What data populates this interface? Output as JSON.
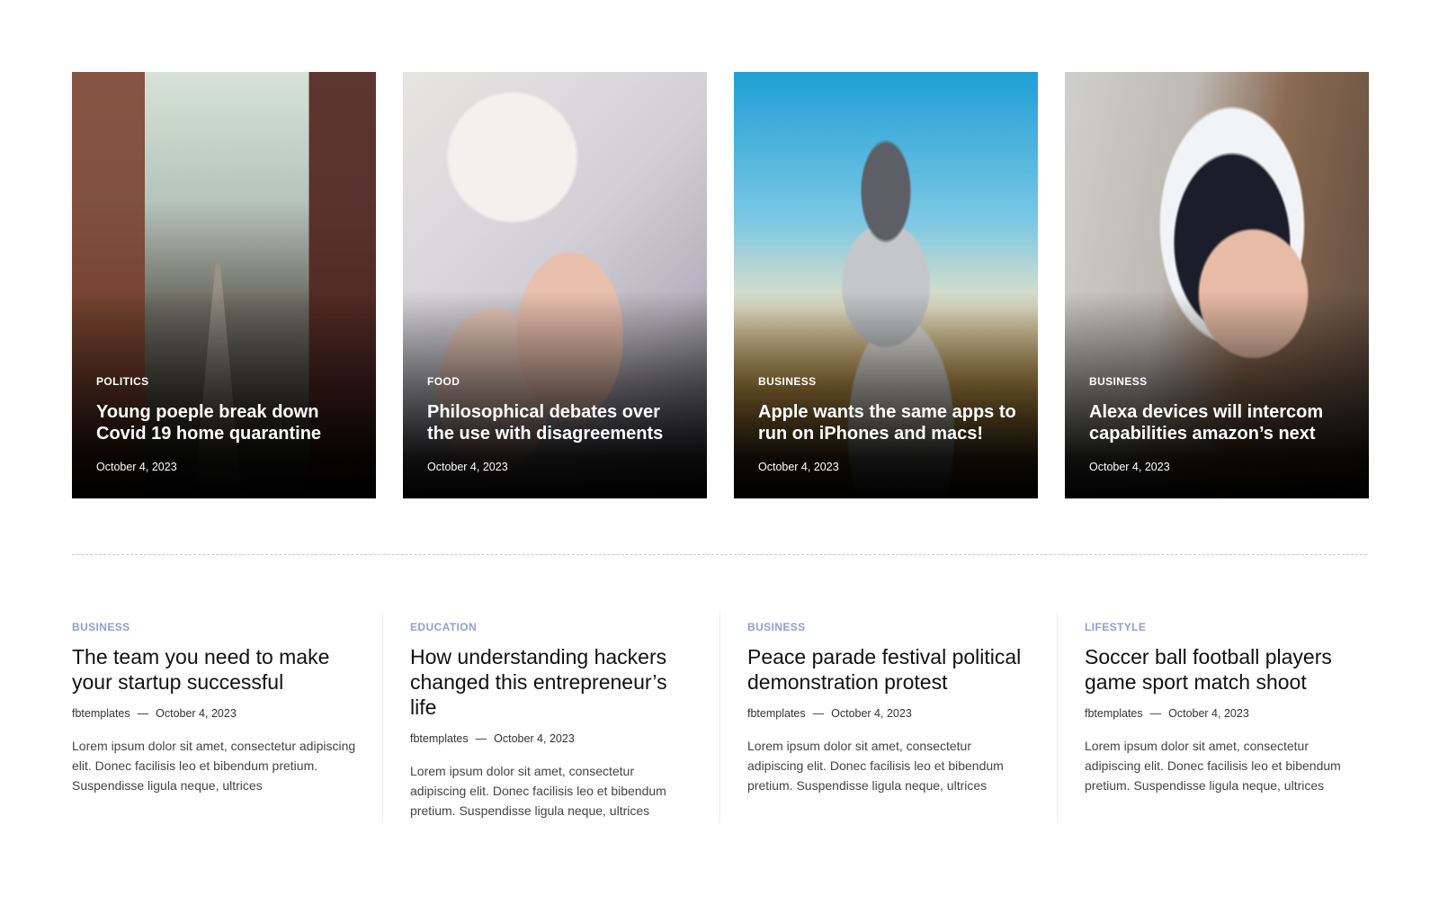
{
  "featured": [
    {
      "category": "POLITICS",
      "title": "Young poeple break down Covid 19 home quarantine",
      "date": "October 4, 2023",
      "image": "city-street-photo"
    },
    {
      "category": "FOOD",
      "title": "Philosophical debates over the use with disagreements",
      "date": "October 4, 2023",
      "image": "manicure-hands-photo"
    },
    {
      "category": "BUSINESS",
      "title": "Apple wants the same apps to run on iPhones and macs!",
      "date": "October 4, 2023",
      "image": "drone-man-photo"
    },
    {
      "category": "BUSINESS",
      "title": "Alexa devices will intercom capabilities amazon’s next",
      "date": "October 4, 2023",
      "image": "vr-headset-photo"
    }
  ],
  "posts": [
    {
      "category": "BUSINESS",
      "title": "The team you need to make your startup successful",
      "author": "fbtemplates",
      "separator": "—",
      "date": "October 4, 2023",
      "excerpt": "Lorem ipsum dolor sit amet, consectetur adipiscing elit. Donec facilisis leo et bibendum pretium. Suspendisse ligula neque, ultrices"
    },
    {
      "category": "EDUCATION",
      "title": "How understanding hackers changed this entrepreneur’s life",
      "author": "fbtemplates",
      "separator": "—",
      "date": "October 4, 2023",
      "excerpt": "Lorem ipsum dolor sit amet, consectetur adipiscing elit. Donec facilisis leo et bibendum pretium. Suspendisse ligula neque, ultrices"
    },
    {
      "category": "BUSINESS",
      "title": "Peace parade festival political demonstration protest",
      "author": "fbtemplates",
      "separator": "—",
      "date": "October 4, 2023",
      "excerpt": "Lorem ipsum dolor sit amet, consectetur adipiscing elit. Donec facilisis leo et bibendum pretium. Suspendisse ligula neque, ultrices"
    },
    {
      "category": "LIFESTYLE",
      "title": "Soccer ball football players game sport match shoot",
      "author": "fbtemplates",
      "separator": "—",
      "date": "October 4, 2023",
      "excerpt": "Lorem ipsum dolor sit amet, consectetur adipiscing elit. Donec facilisis leo et bibendum pretium. Suspendisse ligula neque, ultrices"
    }
  ],
  "colors": {
    "category_accent": "#8fa1cf",
    "title_text": "#111111",
    "card_overlay": "#000000"
  }
}
